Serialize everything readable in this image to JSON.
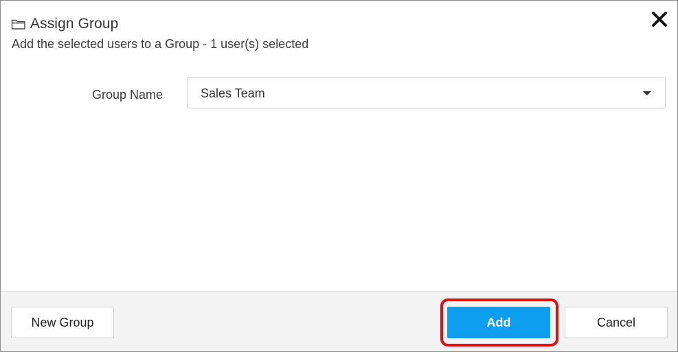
{
  "dialog": {
    "title": "Assign Group",
    "title_icon": "folder-icon",
    "subtitle": "Add the selected users to a Group - 1 user(s) selected",
    "close_icon": "close-icon"
  },
  "form": {
    "group_name_label": "Group Name",
    "group_name_value": "Sales Team",
    "dropdown_icon": "caret-down-icon"
  },
  "footer": {
    "new_group_label": "New Group",
    "add_label": "Add",
    "cancel_label": "Cancel"
  },
  "colors": {
    "primary_button": "#0d9ef0",
    "highlight": "#e01010",
    "footer_background": "#f3f3f3"
  }
}
